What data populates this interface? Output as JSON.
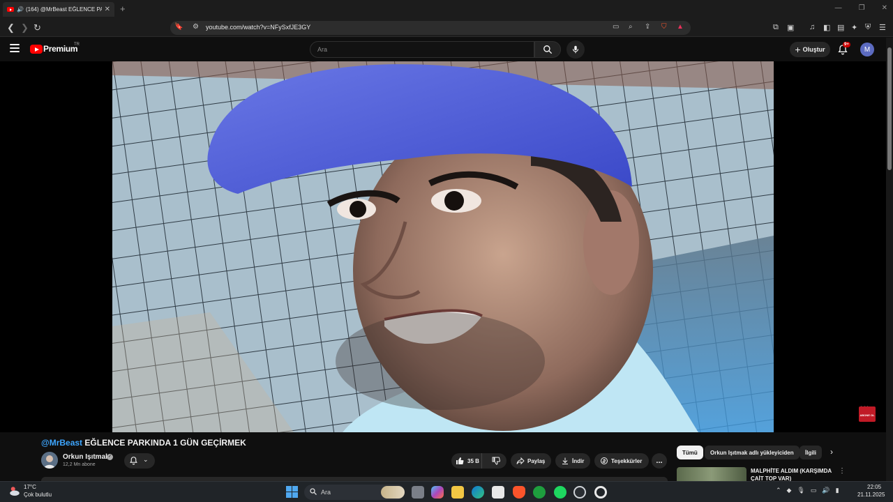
{
  "browser": {
    "tab_title": "(164) @MrBeast EĞLENCE PA",
    "url": "youtube.com/watch?v=NFySxfJE3GY",
    "new_tab_label": "+"
  },
  "youtube": {
    "logo_text": "Premium",
    "country_code": "TR",
    "search_placeholder": "Ara",
    "create_label": "Oluştur",
    "notification_count": "9+",
    "avatar_letter": "M"
  },
  "video": {
    "title_mention": "@MrBeast",
    "title_text": " EĞLENCE PARKINDA 1 GÜN GEÇİRMEK",
    "channel_name": "Orkun Işıtmak",
    "subscribers": "12,2 Mn abone",
    "likes": "35 B",
    "share_label": "Paylaş",
    "download_label": "İndir",
    "thanks_label": "Teşekkürler",
    "more_label": "...",
    "overlay_subscribe": "ABONE OL",
    "overlay_arrows": "↓↓↓"
  },
  "recommendations": {
    "chips": [
      "Tümü",
      "Orkun Işıtmak adlı yükleyiciden",
      "İlgili"
    ],
    "first_title": "MALPHİTE ALDIM (KARŞIMDA ÇAİT TOP VAR)"
  },
  "taskbar": {
    "temperature": "17°C",
    "weather": "Çok bulutlu",
    "search_placeholder": "Ara",
    "time": "22:05",
    "date": "21.11.2025"
  },
  "colors": {
    "yt_red": "#ff0000",
    "link_blue": "#3ea6ff",
    "background": "#0f0f0f",
    "pill_bg": "#272727"
  },
  "icons": [
    "back-icon",
    "forward-icon",
    "reload-icon",
    "bookmark-icon",
    "site-info-icon",
    "cast-icon",
    "zoom-icon",
    "share-icon",
    "brave-shield-icon",
    "rewards-icon",
    "menu-icon",
    "search-icon",
    "mic-icon",
    "bell-icon",
    "like-icon",
    "dislike-icon",
    "share-arrow-icon",
    "download-icon",
    "thanks-icon",
    "chevron-right-icon",
    "windows-start-icon"
  ]
}
